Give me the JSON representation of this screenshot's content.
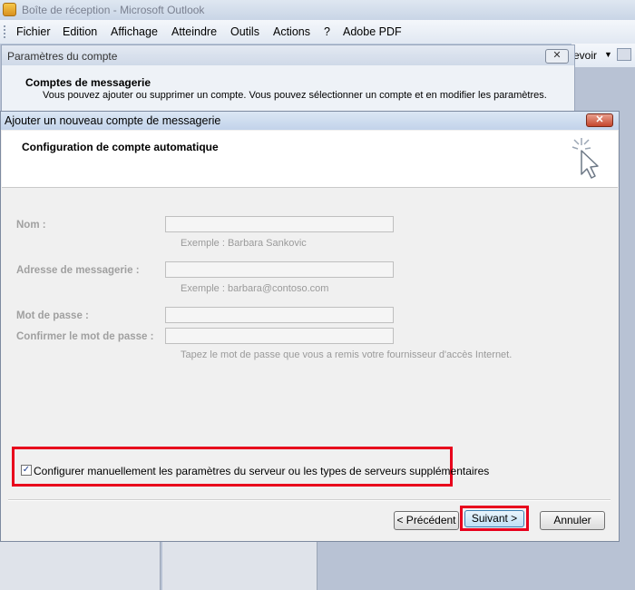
{
  "window": {
    "title": "Boîte de réception - Microsoft Outlook",
    "app_icon": "outlook-icon"
  },
  "menu": [
    "Fichier",
    "Edition",
    "Affichage",
    "Atteindre",
    "Outils",
    "Actions",
    "?",
    "Adobe PDF"
  ],
  "toolbar": {
    "partial_label": "evoir"
  },
  "account_settings": {
    "title": "Paramètres du compte",
    "heading": "Comptes de messagerie",
    "description": "Vous pouvez ajouter ou supprimer un compte. Vous pouvez sélectionner un compte et en modifier les paramètres."
  },
  "dialog": {
    "title": "Ajouter un nouveau compte de messagerie",
    "close_label": "✕",
    "banner_title": "Configuration de compte automatique",
    "fields": {
      "name_label": "Nom :",
      "name_hint": "Exemple : Barbara Sankovic",
      "email_label": "Adresse de messagerie :",
      "email_hint": "Exemple : barbara@contoso.com",
      "password_label": "Mot de passe :",
      "confirm_label": "Confirmer le mot de passe :",
      "password_hint": "Tapez le mot de passe que vous a remis votre fournisseur d'accès Internet."
    },
    "manual_config": {
      "label": "Configurer manuellement les paramètres du serveur ou les types de serveurs supplémentaires",
      "checked": true
    },
    "buttons": {
      "prev": "< Précédent",
      "next": "Suivant >",
      "cancel": "Annuler"
    }
  },
  "colors": {
    "highlight": "#e8001c",
    "dialog_bg": "#f0f0f0",
    "title_bar": "#c2d3ea"
  }
}
